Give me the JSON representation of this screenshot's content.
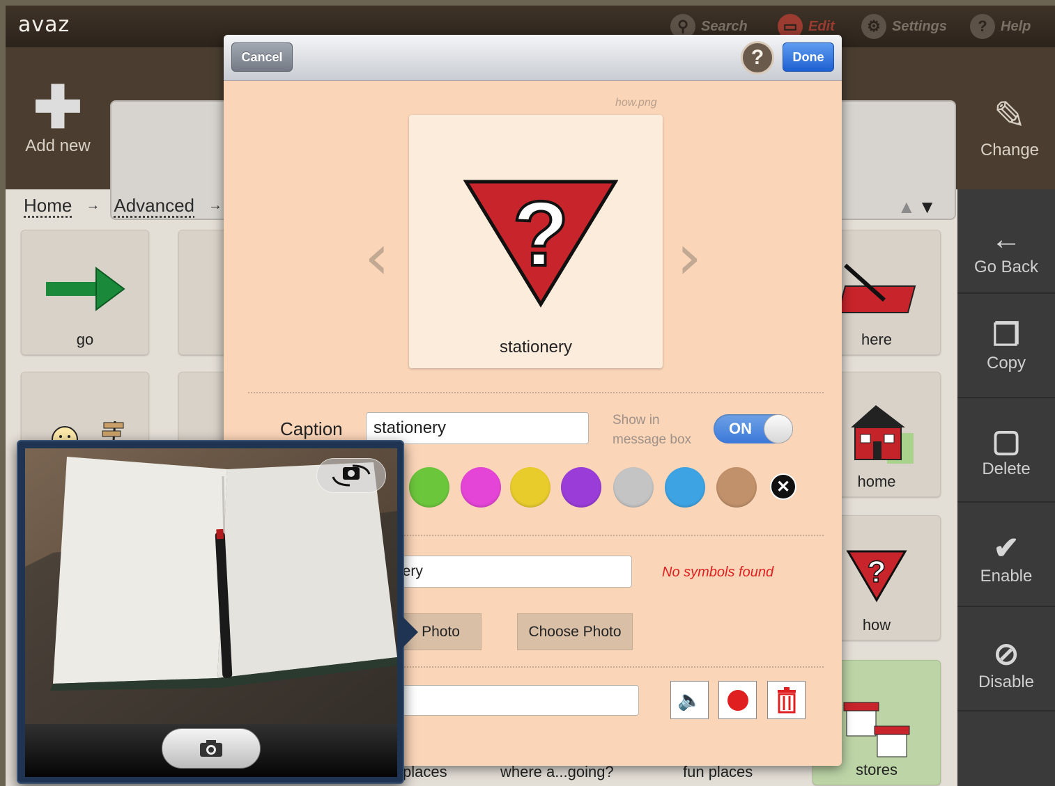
{
  "app": {
    "logo": "avaz",
    "nav": {
      "search": "Search",
      "edit": "Edit",
      "settings": "Settings",
      "help": "Help"
    },
    "edit_bar": {
      "add_new": "Add new",
      "change": "Change"
    },
    "breadcrumb": [
      "Home",
      "Advanced"
    ],
    "sidebar": [
      "Go Back",
      "Copy",
      "Delete",
      "Enable",
      "Disable"
    ],
    "tiles": {
      "go": "go",
      "here": "here",
      "home": "home",
      "how": "how",
      "stores": "stores"
    },
    "bottom_captions": {
      "places": "places",
      "where_going": "where a...going?",
      "fun_places": "fun places"
    }
  },
  "modal": {
    "cancel": "Cancel",
    "help": "?",
    "done": "Done",
    "filename": "how.png",
    "preview_caption": "stationery",
    "caption_label": "Caption",
    "caption_value": "stationery",
    "show_in_message_box_line1": "Show in",
    "show_in_message_box_line2": "message box",
    "toggle_state": "ON",
    "colors": [
      "#6cc63c",
      "#e445d6",
      "#e8cc2c",
      "#9a3dd8",
      "#c4c4c4",
      "#3ea3e3",
      "#c0916a"
    ],
    "symbol_search_value": "nery",
    "no_symbols": "No symbols found",
    "take_photo": "Photo",
    "choose_photo": "Choose Photo"
  },
  "camera": {}
}
